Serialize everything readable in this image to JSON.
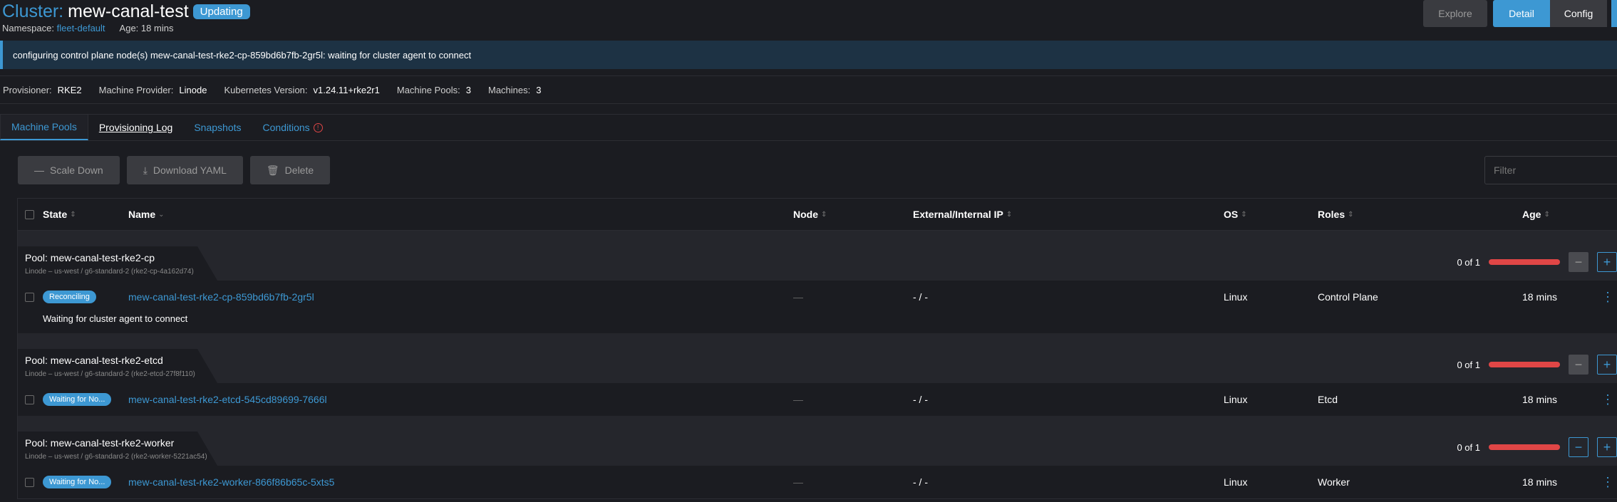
{
  "header": {
    "title_prefix": "Cluster:",
    "cluster_name": "mew-canal-test",
    "status_badge": "Updating",
    "namespace_label": "Namespace:",
    "namespace_value": "fleet-default",
    "age_label": "Age:",
    "age_value": "18 mins"
  },
  "top_buttons": {
    "explore": "Explore",
    "detail": "Detail",
    "config": "Config"
  },
  "banner": "configuring control plane node(s) mew-canal-test-rke2-cp-859bd6b7fb-2gr5l: waiting for cluster agent to connect",
  "meta": [
    {
      "label": "Provisioner:",
      "value": "RKE2"
    },
    {
      "label": "Machine Provider:",
      "value": "Linode"
    },
    {
      "label": "Kubernetes Version:",
      "value": "v1.24.11+rke2r1"
    },
    {
      "label": "Machine Pools:",
      "value": "3"
    },
    {
      "label": "Machines:",
      "value": "3"
    }
  ],
  "tabs": [
    "Machine Pools",
    "Provisioning Log",
    "Snapshots",
    "Conditions"
  ],
  "actions": {
    "scale_down": "Scale Down",
    "download_yaml": "Download YAML",
    "delete": "Delete",
    "filter_placeholder": "Filter"
  },
  "columns": [
    "State",
    "Name",
    "Node",
    "External/Internal IP",
    "OS",
    "Roles",
    "Age"
  ],
  "pools": [
    {
      "title": "Pool: mew-canal-test-rke2-cp",
      "subtitle": "Linode – us-west / g6-standard-2 (rke2-cp-4a162d74)",
      "count": "0 of 1",
      "minus_disabled": true,
      "machine": {
        "state": "Reconciling",
        "name": "mew-canal-test-rke2-cp-859bd6b7fb-2gr5l",
        "node": "—",
        "ip": "- / -",
        "os": "Linux",
        "roles": "Control Plane",
        "age": "18 mins",
        "message": "Waiting for cluster agent to connect"
      }
    },
    {
      "title": "Pool: mew-canal-test-rke2-etcd",
      "subtitle": "Linode – us-west / g6-standard-2 (rke2-etcd-27f8f110)",
      "count": "0 of 1",
      "minus_disabled": true,
      "machine": {
        "state": "Waiting for No...",
        "name": "mew-canal-test-rke2-etcd-545cd89699-7666l",
        "node": "—",
        "ip": "- / -",
        "os": "Linux",
        "roles": "Etcd",
        "age": "18 mins",
        "message": ""
      }
    },
    {
      "title": "Pool: mew-canal-test-rke2-worker",
      "subtitle": "Linode – us-west / g6-standard-2 (rke2-worker-5221ac54)",
      "count": "0 of 1",
      "minus_disabled": false,
      "machine": {
        "state": "Waiting for No...",
        "name": "mew-canal-test-rke2-worker-866f86b65c-5xts5",
        "node": "—",
        "ip": "- / -",
        "os": "Linux",
        "roles": "Worker",
        "age": "18 mins",
        "message": ""
      }
    }
  ],
  "colors": {
    "accent": "#3d98d3",
    "error": "#e04646",
    "background": "#1b1c21"
  }
}
